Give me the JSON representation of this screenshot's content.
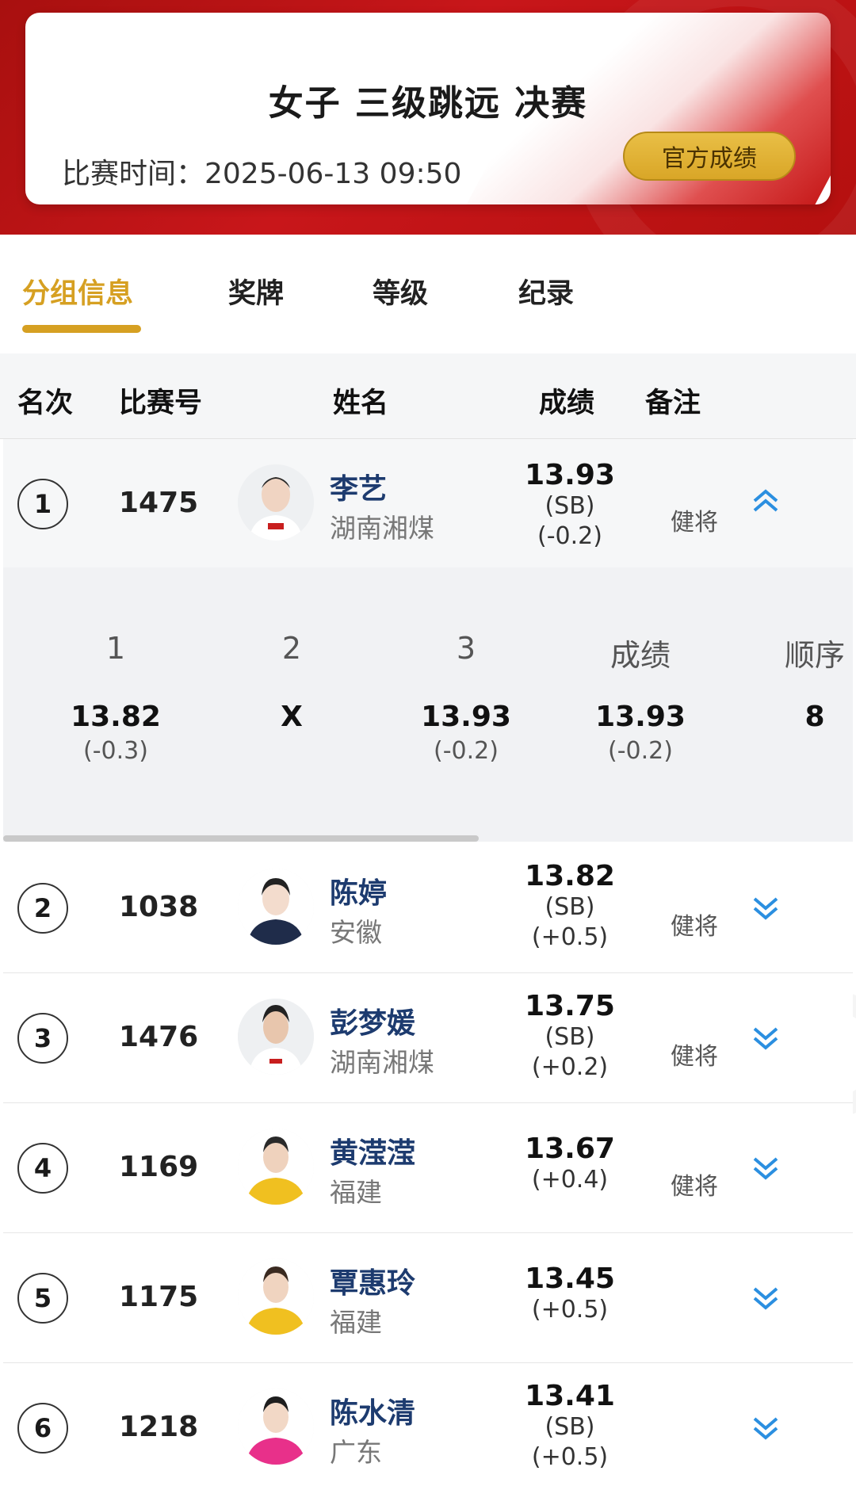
{
  "event": {
    "title": "女子 三级跳远 决赛",
    "time": "比赛时间：2025-06-13 09:50",
    "official_button": "官方成绩"
  },
  "tabs": [
    "分组信息",
    "奖牌",
    "等级",
    "纪录"
  ],
  "table_headers": {
    "rank": "名次",
    "bib": "比赛号",
    "name": "姓名",
    "result": "成绩",
    "note": "备注"
  },
  "rows": [
    {
      "rank": "1",
      "bib": "1475",
      "name": "李艺",
      "team": "湖南湘煤",
      "mark": "13.93",
      "sb": "(SB)",
      "wind": "(-0.2)",
      "note": "健将",
      "expanded": true
    },
    {
      "rank": "2",
      "bib": "1038",
      "name": "陈婷",
      "team": "安徽",
      "mark": "13.82",
      "sb": "(SB)",
      "wind": "(+0.5)",
      "note": "健将",
      "expanded": false
    },
    {
      "rank": "3",
      "bib": "1476",
      "name": "彭梦媛",
      "team": "湖南湘煤",
      "mark": "13.75",
      "sb": "(SB)",
      "wind": "(+0.2)",
      "note": "健将",
      "expanded": false
    },
    {
      "rank": "4",
      "bib": "1169",
      "name": "黄滢滢",
      "team": "福建",
      "mark": "13.67",
      "sb": "",
      "wind": "(+0.4)",
      "note": "健将",
      "expanded": false
    },
    {
      "rank": "5",
      "bib": "1175",
      "name": "覃惠玲",
      "team": "福建",
      "mark": "13.45",
      "sb": "",
      "wind": "(+0.5)",
      "note": "",
      "expanded": false
    },
    {
      "rank": "6",
      "bib": "1218",
      "name": "陈水清",
      "team": "广东",
      "mark": "13.41",
      "sb": "(SB)",
      "wind": "(+0.5)",
      "note": "",
      "expanded": false
    }
  ],
  "attempts_panel": {
    "headers": [
      "1",
      "2",
      "3",
      "成绩",
      "顺序"
    ],
    "values": [
      "13.82",
      "X",
      "13.93",
      "13.93",
      "8"
    ],
    "winds": [
      "(-0.3)",
      "",
      "(-0.2)",
      "(-0.2)",
      ""
    ]
  },
  "colors": {
    "banner_red": "#c8161a",
    "gold": "#d6a022",
    "name_blue": "#1d3b6f",
    "chevron_blue": "#2b8fe0"
  },
  "icons": {
    "expand": "chevron-double-down-icon",
    "collapse": "chevron-double-up-icon"
  }
}
